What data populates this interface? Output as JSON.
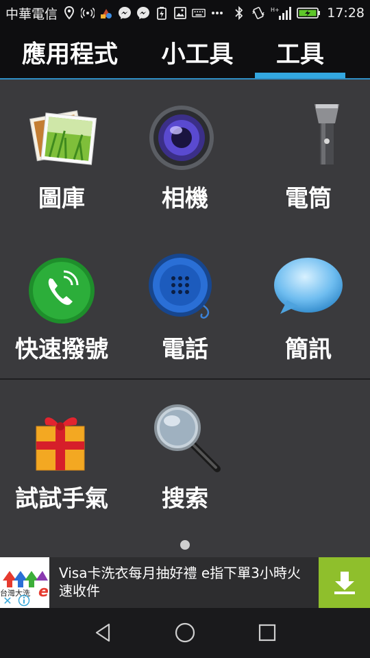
{
  "status_bar": {
    "carrier": "中華電信",
    "time": "17:28",
    "icons_left": [
      "location-icon",
      "hotspot-icon",
      "app-icon",
      "messenger-icon",
      "messenger-icon",
      "battery-saver-icon",
      "gallery-icon",
      "keyboard-icon",
      "more-icon"
    ],
    "icons_right": [
      "bluetooth-icon",
      "vibrate-icon",
      "signal-icon",
      "battery-icon"
    ],
    "signal_type": "H+",
    "battery_color": "#5ec62a"
  },
  "tabs": [
    {
      "label": "應用程式",
      "active": false
    },
    {
      "label": "小工具",
      "active": false
    },
    {
      "label": "工具",
      "active": true
    }
  ],
  "accent_color": "#33a7e0",
  "apps": [
    {
      "label": "圖庫",
      "icon": "gallery-icon"
    },
    {
      "label": "相機",
      "icon": "camera-icon"
    },
    {
      "label": "電筒",
      "icon": "flashlight-icon"
    },
    {
      "label": "快速撥號",
      "icon": "speed-dial-icon"
    },
    {
      "label": "電話",
      "icon": "phone-icon"
    },
    {
      "label": "簡訊",
      "icon": "message-icon"
    },
    {
      "label": "試試手氣",
      "icon": "gift-icon"
    },
    {
      "label": "搜索",
      "icon": "search-icon"
    }
  ],
  "ad": {
    "logo_text": "台灣大洗",
    "logo_letter": "e",
    "text": "Visa卡洗衣每月抽好禮 e指下單3小時火速收件",
    "download_color": "#8fbf2c"
  }
}
